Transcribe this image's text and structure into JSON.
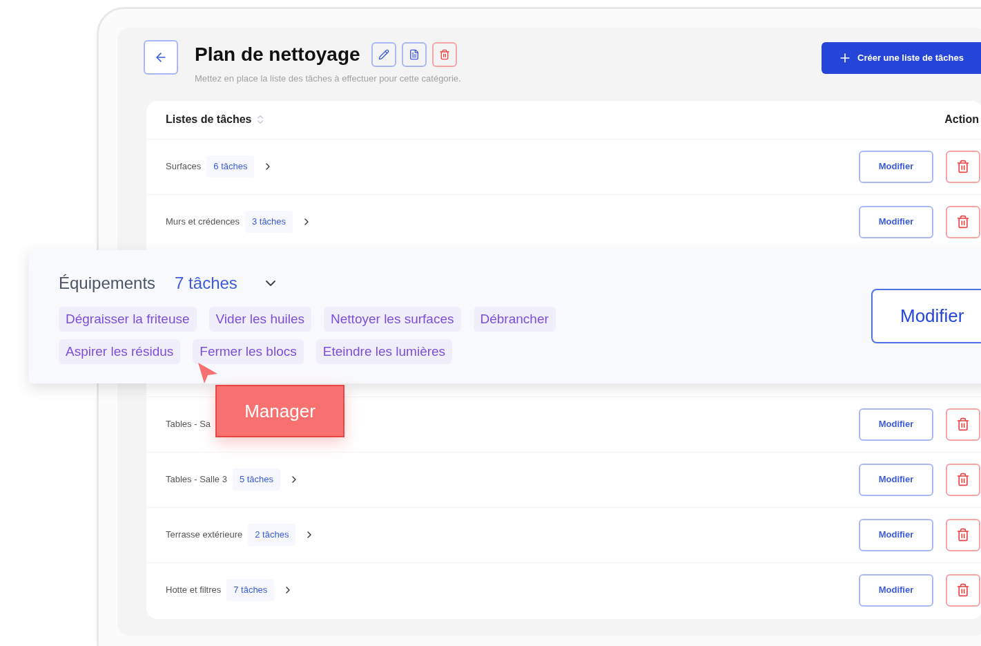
{
  "header": {
    "title": "Plan de nettoyage",
    "subtitle": "Mettez en place la liste des tâches à effectuer pour cette catégorie.",
    "create_button": "Créer une liste de tâches"
  },
  "table": {
    "columns": [
      "Listes de tâches",
      "Action"
    ],
    "rows": [
      {
        "kind": "row",
        "name": "Surfaces",
        "count": "6 tâches",
        "edit": "Modifier"
      },
      {
        "kind": "row",
        "name": "Murs et crédences",
        "count": "3 tâches",
        "edit": "Modifier"
      },
      {
        "kind": "hidden"
      },
      {
        "kind": "row",
        "name": "Tables - Sa",
        "edit": "Modifier"
      },
      {
        "kind": "row",
        "name": "Tables - Salle 3",
        "count": "5 tâches",
        "edit": "Modifier"
      },
      {
        "kind": "row",
        "name": "Terrasse extérieure",
        "count": "2 tâches",
        "edit": "Modifier"
      },
      {
        "kind": "row",
        "name": "Hotte et filtres",
        "count": "7 tâches",
        "edit": "Modifier"
      }
    ]
  },
  "expanded_row": {
    "name": "Équipements",
    "count": "7 tâches",
    "expanded": true,
    "edit": "Modifier",
    "tasks": [
      "Dégraisser la friteuse",
      "Vider les huiles",
      "Nettoyer les surfaces",
      "Débrancher",
      "Aspirer les résidus",
      "Fermer les blocs",
      "Eteindre les lumières"
    ]
  },
  "role_tag": "Manager"
}
